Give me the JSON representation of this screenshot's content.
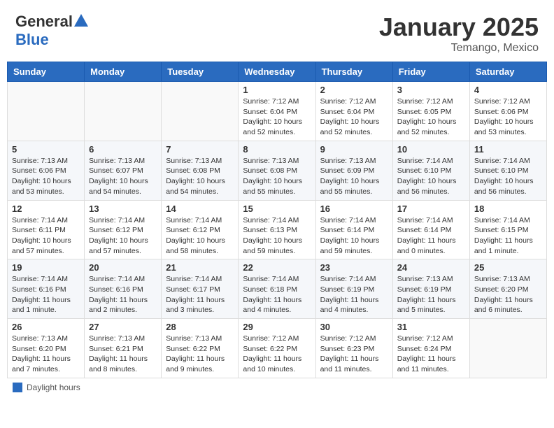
{
  "header": {
    "logo_general": "General",
    "logo_blue": "Blue",
    "month_title": "January 2025",
    "location": "Temango, Mexico"
  },
  "days_of_week": [
    "Sunday",
    "Monday",
    "Tuesday",
    "Wednesday",
    "Thursday",
    "Friday",
    "Saturday"
  ],
  "weeks": [
    [
      {
        "day": "",
        "info": ""
      },
      {
        "day": "",
        "info": ""
      },
      {
        "day": "",
        "info": ""
      },
      {
        "day": "1",
        "info": "Sunrise: 7:12 AM\nSunset: 6:04 PM\nDaylight: 10 hours and 52 minutes."
      },
      {
        "day": "2",
        "info": "Sunrise: 7:12 AM\nSunset: 6:04 PM\nDaylight: 10 hours and 52 minutes."
      },
      {
        "day": "3",
        "info": "Sunrise: 7:12 AM\nSunset: 6:05 PM\nDaylight: 10 hours and 52 minutes."
      },
      {
        "day": "4",
        "info": "Sunrise: 7:12 AM\nSunset: 6:06 PM\nDaylight: 10 hours and 53 minutes."
      }
    ],
    [
      {
        "day": "5",
        "info": "Sunrise: 7:13 AM\nSunset: 6:06 PM\nDaylight: 10 hours and 53 minutes."
      },
      {
        "day": "6",
        "info": "Sunrise: 7:13 AM\nSunset: 6:07 PM\nDaylight: 10 hours and 54 minutes."
      },
      {
        "day": "7",
        "info": "Sunrise: 7:13 AM\nSunset: 6:08 PM\nDaylight: 10 hours and 54 minutes."
      },
      {
        "day": "8",
        "info": "Sunrise: 7:13 AM\nSunset: 6:08 PM\nDaylight: 10 hours and 55 minutes."
      },
      {
        "day": "9",
        "info": "Sunrise: 7:13 AM\nSunset: 6:09 PM\nDaylight: 10 hours and 55 minutes."
      },
      {
        "day": "10",
        "info": "Sunrise: 7:14 AM\nSunset: 6:10 PM\nDaylight: 10 hours and 56 minutes."
      },
      {
        "day": "11",
        "info": "Sunrise: 7:14 AM\nSunset: 6:10 PM\nDaylight: 10 hours and 56 minutes."
      }
    ],
    [
      {
        "day": "12",
        "info": "Sunrise: 7:14 AM\nSunset: 6:11 PM\nDaylight: 10 hours and 57 minutes."
      },
      {
        "day": "13",
        "info": "Sunrise: 7:14 AM\nSunset: 6:12 PM\nDaylight: 10 hours and 57 minutes."
      },
      {
        "day": "14",
        "info": "Sunrise: 7:14 AM\nSunset: 6:12 PM\nDaylight: 10 hours and 58 minutes."
      },
      {
        "day": "15",
        "info": "Sunrise: 7:14 AM\nSunset: 6:13 PM\nDaylight: 10 hours and 59 minutes."
      },
      {
        "day": "16",
        "info": "Sunrise: 7:14 AM\nSunset: 6:14 PM\nDaylight: 10 hours and 59 minutes."
      },
      {
        "day": "17",
        "info": "Sunrise: 7:14 AM\nSunset: 6:14 PM\nDaylight: 11 hours and 0 minutes."
      },
      {
        "day": "18",
        "info": "Sunrise: 7:14 AM\nSunset: 6:15 PM\nDaylight: 11 hours and 1 minute."
      }
    ],
    [
      {
        "day": "19",
        "info": "Sunrise: 7:14 AM\nSunset: 6:16 PM\nDaylight: 11 hours and 1 minute."
      },
      {
        "day": "20",
        "info": "Sunrise: 7:14 AM\nSunset: 6:16 PM\nDaylight: 11 hours and 2 minutes."
      },
      {
        "day": "21",
        "info": "Sunrise: 7:14 AM\nSunset: 6:17 PM\nDaylight: 11 hours and 3 minutes."
      },
      {
        "day": "22",
        "info": "Sunrise: 7:14 AM\nSunset: 6:18 PM\nDaylight: 11 hours and 4 minutes."
      },
      {
        "day": "23",
        "info": "Sunrise: 7:14 AM\nSunset: 6:19 PM\nDaylight: 11 hours and 4 minutes."
      },
      {
        "day": "24",
        "info": "Sunrise: 7:13 AM\nSunset: 6:19 PM\nDaylight: 11 hours and 5 minutes."
      },
      {
        "day": "25",
        "info": "Sunrise: 7:13 AM\nSunset: 6:20 PM\nDaylight: 11 hours and 6 minutes."
      }
    ],
    [
      {
        "day": "26",
        "info": "Sunrise: 7:13 AM\nSunset: 6:20 PM\nDaylight: 11 hours and 7 minutes."
      },
      {
        "day": "27",
        "info": "Sunrise: 7:13 AM\nSunset: 6:21 PM\nDaylight: 11 hours and 8 minutes."
      },
      {
        "day": "28",
        "info": "Sunrise: 7:13 AM\nSunset: 6:22 PM\nDaylight: 11 hours and 9 minutes."
      },
      {
        "day": "29",
        "info": "Sunrise: 7:12 AM\nSunset: 6:22 PM\nDaylight: 11 hours and 10 minutes."
      },
      {
        "day": "30",
        "info": "Sunrise: 7:12 AM\nSunset: 6:23 PM\nDaylight: 11 hours and 11 minutes."
      },
      {
        "day": "31",
        "info": "Sunrise: 7:12 AM\nSunset: 6:24 PM\nDaylight: 11 hours and 11 minutes."
      },
      {
        "day": "",
        "info": ""
      }
    ]
  ],
  "footer": {
    "label": "Daylight hours"
  }
}
